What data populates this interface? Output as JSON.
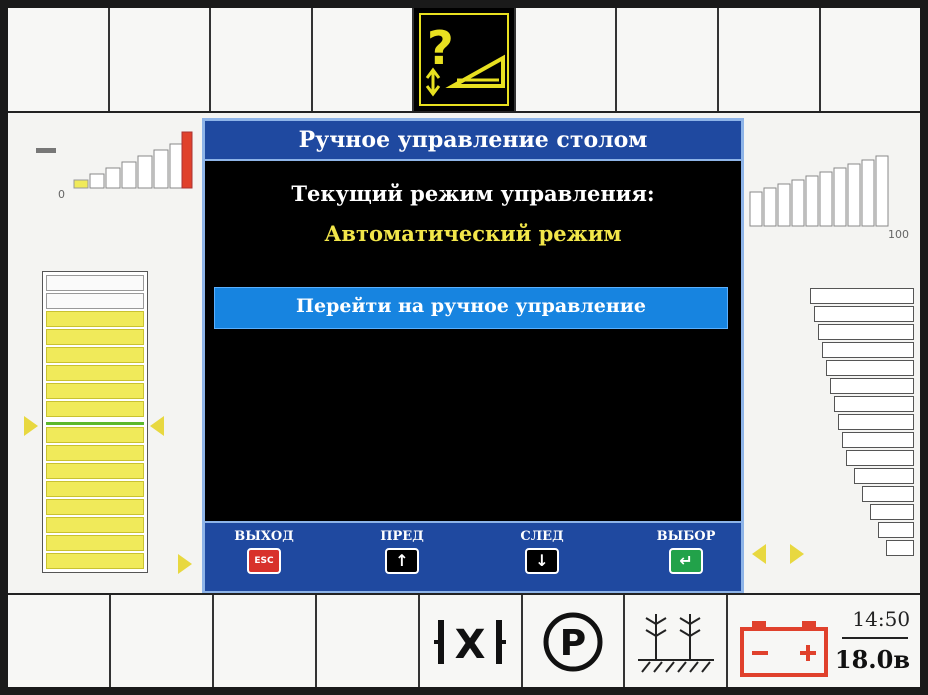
{
  "dialog": {
    "title": "Ручное управление столом",
    "status_label": "Текущий режим управления:",
    "status_value": "Автоматический режим",
    "menu_item": "Перейти на ручное управление",
    "footer": {
      "exit_label": "ВЫХОД",
      "exit_key": "ESC",
      "prev_label": "ПРЕД",
      "prev_key": "↑",
      "next_label": "СЛЕД",
      "next_key": "↓",
      "select_label": "ВЫБОР",
      "select_key": "↵"
    }
  },
  "left_panel": {
    "scale_min": "0"
  },
  "right_panel": {
    "scale_max": "100"
  },
  "status": {
    "time": "14:50",
    "voltage": "18.0в"
  },
  "icons": {
    "top_active": "help-table-icon",
    "bottom": [
      "float-lock-icon",
      "parking-icon",
      "crop-field-icon",
      "battery-icon"
    ]
  },
  "colors": {
    "dialog_bg": "#000000",
    "title_bar": "#1f49a0",
    "selection": "#1784e0",
    "highlight_text": "#f2e64a",
    "warning_red": "#e0412c"
  }
}
